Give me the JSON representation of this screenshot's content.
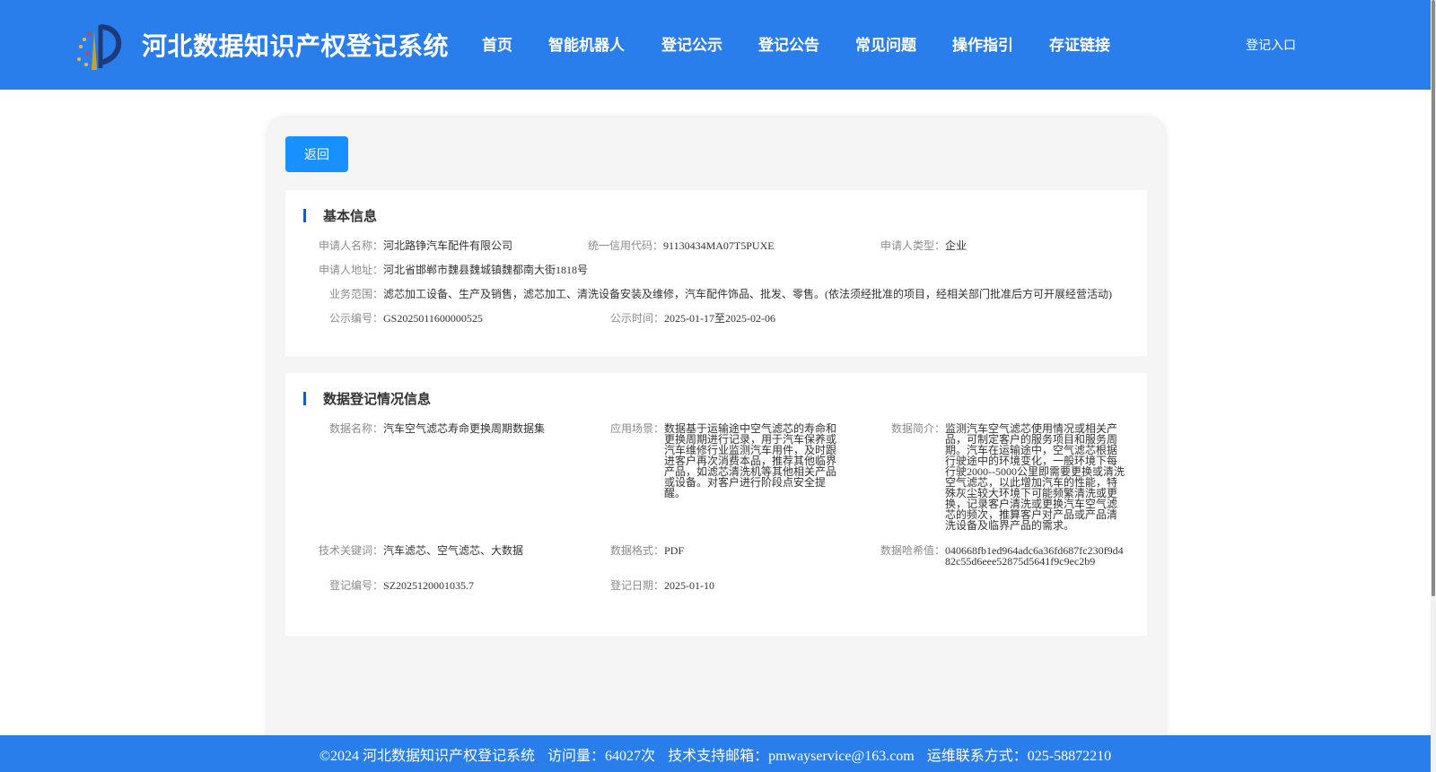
{
  "header": {
    "site_title": "河北数据知识产权登记系统",
    "nav": [
      "首页",
      "智能机器人",
      "登记公示",
      "登记公告",
      "常见问题",
      "操作指引",
      "存证链接"
    ],
    "login_label": "登记入口",
    "colors": {
      "header_bg": "#2a7eec",
      "primary_button": "#1890ff",
      "title_marker": "#1a5cb3"
    }
  },
  "back_label": "返回",
  "basic_info": {
    "title": "基本信息",
    "applicant_name_label": "申请人名称：",
    "applicant_name": "河北路铮汽车配件有限公司",
    "credit_code_label": "统一信用代码：",
    "credit_code": "91130434MA07T5PUXE",
    "applicant_type_label": "申请人类型：",
    "applicant_type": "企业",
    "address_label": "申请人地址：",
    "address": "河北省邯郸市魏县魏城镇魏都南大街1818号",
    "business_scope_label": "业务范围：",
    "business_scope": "滤芯加工设备、生产及销售，滤芯加工、清洗设备安装及维修，汽车配件饰品、批发、零售。(依法须经批准的项目，经相关部门批准后方可开展经营活动)",
    "notice_no_label": "公示编号：",
    "notice_no": "GS2025011600000525",
    "notice_time_label": "公示时间：",
    "notice_time": "2025-01-17至2025-02-06"
  },
  "data_info": {
    "title": "数据登记情况信息",
    "data_name_label": "数据名称：",
    "data_name": "汽车空气滤芯寿命更换周期数据集",
    "scenario_label": "应用场景：",
    "scenario": "数据基于运输途中空气滤芯的寿命和更换周期进行记录，用于汽车保养或汽车维修行业监测汽车用件，及时跟进客户再次消费本品，推荐其他临界产品，如滤芯清洗机等其他相关产品或设备。对客户进行阶段点安全提醒。",
    "summary_label": "数据简介：",
    "summary": "监测汽车空气滤芯使用情况或相关产品，可制定客户的服务项目和服务周期。汽车在运输途中，空气滤芯根据行驶途中的环境变化，一般环境下每行驶2000--5000公里即需要更换或清洗空气滤芯，以此增加汽车的性能，特殊灰尘较大环境下可能频繁清洗或更换，记录客户清洗或更换汽车空气滤芯的频次，推算客户对产品或产品清洗设备及临界产品的需求。",
    "keywords_label": "技术关键词：",
    "keywords": "汽车滤芯、空气滤芯、大数据",
    "format_label": "数据格式：",
    "format": "PDF",
    "hash_label": "数据哈希值：",
    "hash": "040668fb1ed964adc6a36fd687fc230f9d482c55d6eee52875d5641f9c9ec2b9",
    "reg_no_label": "登记编号：",
    "reg_no": "SZ2025120001035.7",
    "reg_date_label": "登记日期：",
    "reg_date": "2025-01-10"
  },
  "footer": {
    "copyright": "©2024 河北数据知识产权登记系统",
    "visits": "访问量：64027次",
    "email": "技术支持邮箱：pmwayservice@163.com",
    "phone": "运维联系方式：025-58872210"
  }
}
